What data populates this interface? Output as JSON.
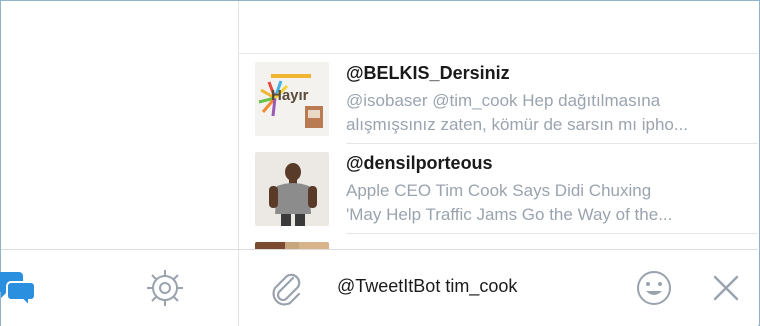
{
  "results": [
    {
      "name": "@BELKIS_Dersiniz",
      "line1": "@isobaser @tim_cook Hep dağıtılmasına",
      "line2": "alışmışsınız zaten, kömür de sarsın mı ipho...",
      "thumb_text": "Hayır"
    },
    {
      "name": "@densilporteous",
      "line1": "Apple CEO Tim Cook Says Didi Chuxing",
      "line2": "'May Help Traffic Jams Go the Way of the..."
    }
  ],
  "compose": {
    "text": "@TweetItBot tim_cook"
  },
  "icons": {
    "chat": "chat-bubbles-icon",
    "settings": "gear-icon",
    "attach": "paperclip-icon",
    "emoji": "emoji-icon",
    "close": "close-icon"
  },
  "colors": {
    "accent": "#2b8fe0",
    "muted_icon": "#9aa3ad",
    "secondary_text": "#9aa4af"
  }
}
